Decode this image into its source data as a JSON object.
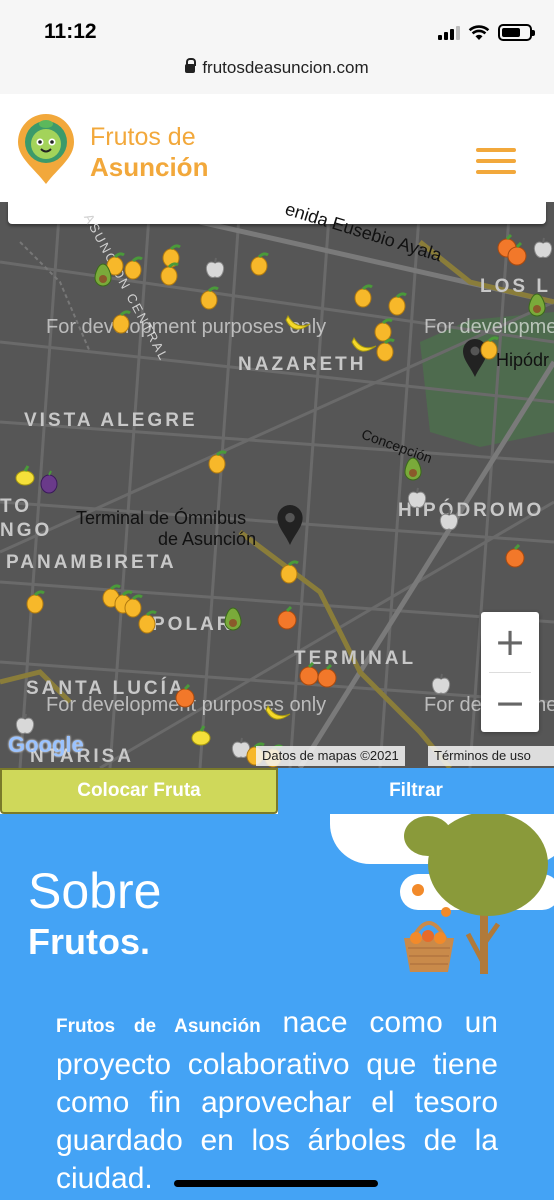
{
  "status_bar": {
    "time": "11:12",
    "url": "frutosdeasuncion.com"
  },
  "header": {
    "brand_line1": "Frutos de",
    "brand_line2": "Asunción"
  },
  "map": {
    "labels": {
      "street_eusebio": "enida Eusebio Ayala",
      "asuncion_central": "ASUNCION CENTRAL",
      "los": "LOS L",
      "nazareth": "NAZARETH",
      "hipodromo_place": "Hipódr",
      "vista_alegre": "VISTA ALEGRE",
      "concepcion": "Concepción",
      "hipodromo": "HIPÓDROMO",
      "terminal_omnibus_1": "Terminal de Ómnibus",
      "terminal_omnibus_2": "de Asunción",
      "to": "TO",
      "ngo": "NGO",
      "panambireta": "PANAMBIRETA",
      "polar": "POLAR",
      "terminal": "TERMINAL",
      "santa_lucia": "SANTA LUCÍA",
      "ntarisa": "NTARISA"
    },
    "watermark": "For development purposes only",
    "google": "Google",
    "attribution": "Datos de mapas ©2021",
    "terms": "Términos de uso",
    "zoom_in": "+",
    "zoom_out": "−"
  },
  "actions": {
    "place_fruit": "Colocar Fruta",
    "filter": "Filtrar"
  },
  "about": {
    "title_line1": "Sobre",
    "title_line2": "Frutos.",
    "body_em": "Frutos de Asunción",
    "body_rest": " nace como un proyecto colaborativo que tiene como fin aprovechar el tesoro guardado en los árboles de la ciudad."
  },
  "colors": {
    "brand_orange": "#f2a83b",
    "map_bg": "#565656",
    "filter_blue": "#44a3f5",
    "place_green": "#cfd85a"
  }
}
